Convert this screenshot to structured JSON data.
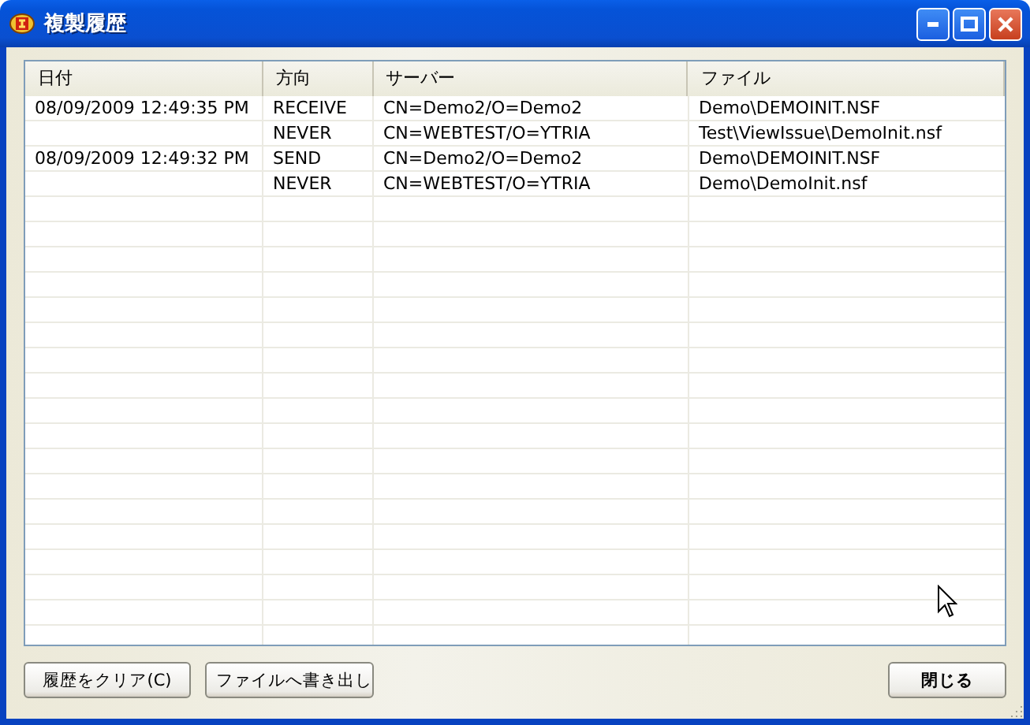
{
  "window": {
    "title": "複製履歴"
  },
  "table": {
    "columns": [
      "日付",
      "方向",
      "サーバー",
      "ファイル"
    ],
    "rows": [
      [
        "08/09/2009 12:49:35 PM",
        "RECEIVE",
        "CN=Demo2/O=Demo2",
        "Demo\\DEMOINIT.NSF"
      ],
      [
        "",
        "NEVER",
        "CN=WEBTEST/O=YTRIA",
        "Test\\ViewIssue\\DemoInit.nsf"
      ],
      [
        "08/09/2009 12:49:32 PM",
        "SEND",
        "CN=Demo2/O=Demo2",
        "Demo\\DEMOINIT.NSF"
      ],
      [
        "",
        "NEVER",
        "CN=WEBTEST/O=YTRIA",
        "Demo\\DemoInit.nsf"
      ]
    ]
  },
  "buttons": [
    {
      "label": "履歴をクリア(C)",
      "kind": "normal"
    },
    {
      "label": "ファイルへ書き出し",
      "kind": "normal"
    },
    {
      "label": "閉じる",
      "kind": "default"
    }
  ]
}
